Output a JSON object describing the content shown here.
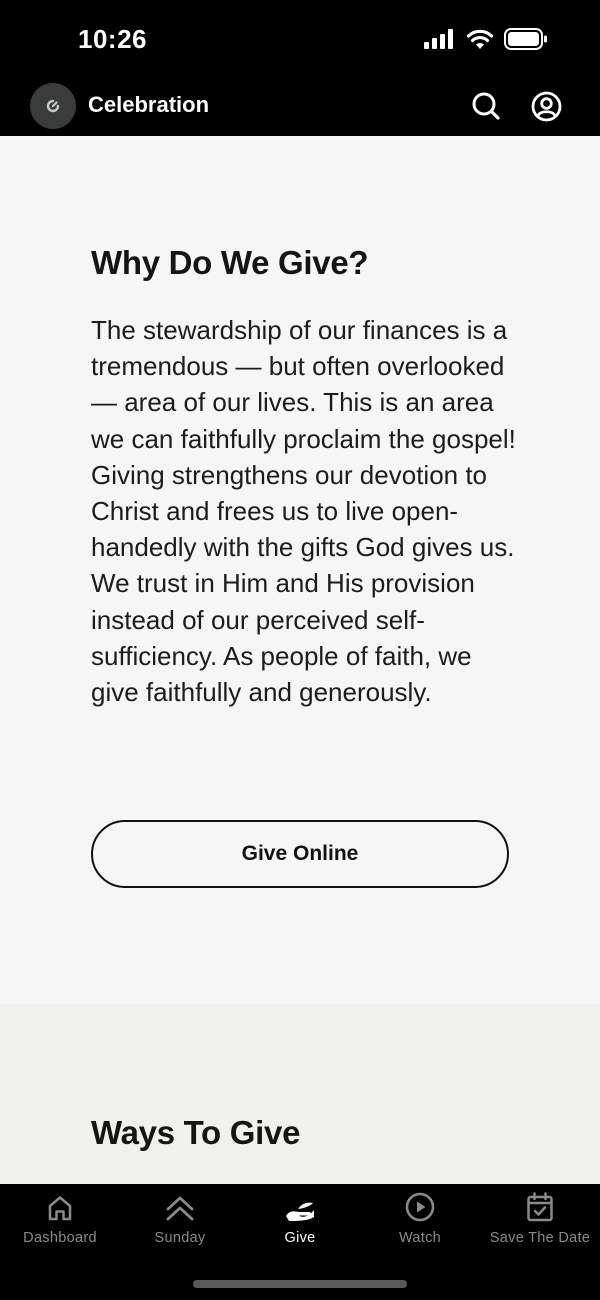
{
  "status": {
    "time": "10:26"
  },
  "header": {
    "title": "Celebration",
    "logo_icon": "church-logo-icon",
    "search_icon": "search-icon",
    "account_icon": "account-icon"
  },
  "why": {
    "heading": "Why Do We Give?",
    "body": "The stewardship of our finances is a tremendous — but often overlooked — area of our lives. This is an area we can faithfully proclaim the gospel! Giving strengthens our devotion to Christ and frees us to live open-handedly with the gifts God gives us. We trust in Him and His provision instead of our perceived self-sufficiency. As people of faith, we give faithfully and generously.",
    "button_label": "Give Online"
  },
  "ways": {
    "heading": "Ways To Give"
  },
  "tabs": [
    {
      "label": "Dashboard",
      "icon": "home-icon",
      "active": false
    },
    {
      "label": "Sunday",
      "icon": "double-chevron-up-icon",
      "active": false
    },
    {
      "label": "Give",
      "icon": "giving-hand-icon",
      "active": true
    },
    {
      "label": "Watch",
      "icon": "play-circle-icon",
      "active": false
    },
    {
      "label": "Save The Date",
      "icon": "calendar-check-icon",
      "active": false
    }
  ],
  "colors": {
    "content_bg": "#f6f6f6",
    "section_alt_bg": "#f0f0ed",
    "bar_bg": "#000000",
    "tab_inactive": "#8b8b8b",
    "tab_active": "#ffffff"
  }
}
